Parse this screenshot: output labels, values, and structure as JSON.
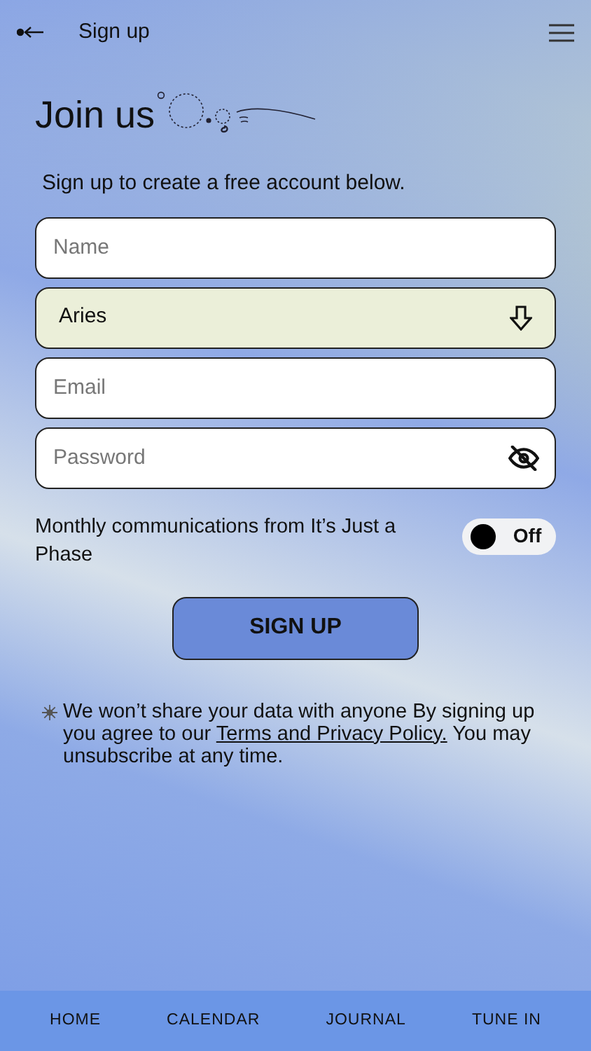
{
  "header": {
    "title": "Sign up"
  },
  "heading": "Join us",
  "subtitle": "Sign up to create a free account below.",
  "fields": [
    {
      "kind": "text",
      "placeholder": "Name"
    },
    {
      "kind": "select",
      "value": "Aries"
    },
    {
      "kind": "text",
      "placeholder": "Email"
    },
    {
      "kind": "password",
      "placeholder": "Password"
    }
  ],
  "newsletter": {
    "label": "Monthly communications from It’s Just a Phase",
    "on": false,
    "state_label": "Off"
  },
  "submit": "SIGN UP",
  "disclaimer": {
    "before": "We won’t share your data with anyone By signing up you agree to our",
    "link": "Terms and Privacy Policy.",
    "after": "You may unsubscribe at any time."
  },
  "nav": [
    "HOME",
    "CALENDAR",
    "JOURNAL",
    "TUNE IN"
  ]
}
